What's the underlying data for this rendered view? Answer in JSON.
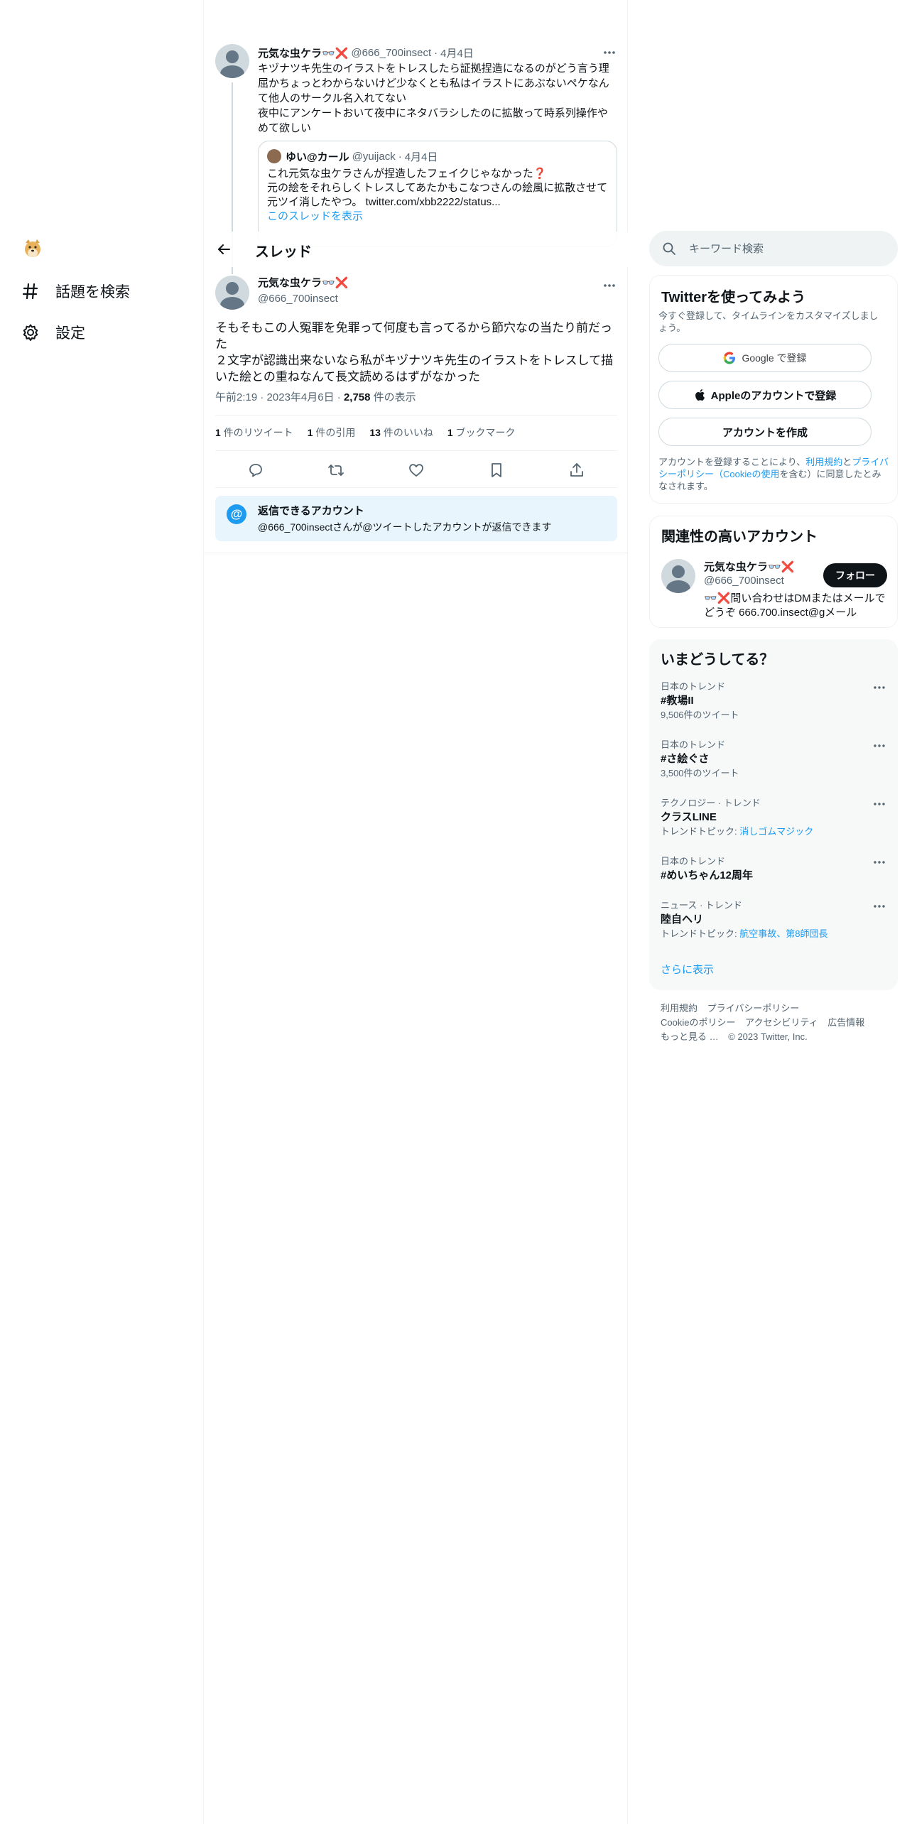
{
  "nav": {
    "items": [
      {
        "label": "話題を検索",
        "icon": "hash-icon"
      },
      {
        "label": "設定",
        "icon": "gear-icon"
      }
    ]
  },
  "parent_tweet": {
    "name": "元気な虫ケラ👓❌",
    "handle": "@666_700insect",
    "sep": "·",
    "date": "4月4日",
    "text_lines": [
      "キヅナツキ先生のイラストをトレスしたら証拠捏造になるのがどう言う理",
      "屈かちょっとわからないけど少なくとも私はイラストにあぶないペケなん",
      "て他人のサークル名入れてない",
      "夜中にアンケートおいて夜中にネタバラシしたのに拡散って時系列操作や",
      "めて欲しい"
    ],
    "quote": {
      "name": "ゆい@カール",
      "handle": "@yuijack",
      "sep": "·",
      "date": "4月4日",
      "lines": [
        "これ元気な虫ケラさんが捏造したフェイクじゃなかった❓",
        "元の絵をそれらしくトレスしてあたかもこなつさんの絵風に拡散させて",
        "元ツイ消したやつ。 twitter.com/xbb2222/status..."
      ],
      "show_thread": "このスレッドを表示"
    }
  },
  "header": {
    "title": "スレッド"
  },
  "focus_tweet": {
    "name": "元気な虫ケラ👓❌",
    "handle": "@666_700insect",
    "text_lines": [
      "そもそもこの人冤罪を免罪って何度も言ってるから節穴なの当たり前だっ",
      "た",
      "２文字が認識出来ないなら私がキヅナツキ先生のイラストをトレスして描",
      "いた絵との重ねなんて長文読めるはずがなかった"
    ],
    "time": "午前2:19",
    "sep1": "·",
    "date": "2023年4月6日",
    "sep2": "·",
    "views": "2,758",
    "views_label": "件の表示",
    "stats": [
      {
        "count": "1",
        "label": "件のリツイート"
      },
      {
        "count": "1",
        "label": "件の引用"
      },
      {
        "count": "13",
        "label": "件のいいね"
      },
      {
        "count": "1",
        "label": "ブックマーク"
      }
    ]
  },
  "reply_notice": {
    "title": "返信できるアカウント",
    "desc": "@666_700insectさんが@ツイートしたアカウントが返信できます"
  },
  "search": {
    "placeholder": "キーワード検索"
  },
  "signup": {
    "title": "Twitterを使ってみよう",
    "subtitle": "今すぐ登録して、タイムラインをカスタマイズしましょう。",
    "google": "Google で登録",
    "apple": "Appleのアカウントで登録",
    "create": "アカウントを作成",
    "terms_pre": "アカウントを登録することにより、",
    "terms_link1": "利用規約",
    "terms_and": "と",
    "terms_link2": "プライバシーポリシー（Cookieの使用",
    "terms_post": "を含む）に同意したとみなされます。"
  },
  "related": {
    "title": "関連性の高いアカウント",
    "name": "元気な虫ケラ👓❌",
    "handle": "@666_700insect",
    "follow": "フォロー",
    "bio": "👓❌問い合わせはDMまたはメールでどうぞ 666.700.insect@gメール"
  },
  "trends": {
    "title": "いまどうしてる？",
    "items": [
      {
        "category": "日本のトレンド",
        "name": "#教場II",
        "sub": "9,506件のツイート",
        "topic_label": "",
        "topic": ""
      },
      {
        "category": "日本のトレンド",
        "name": "#さ絵ぐさ",
        "sub": "3,500件のツイート",
        "topic_label": "",
        "topic": ""
      },
      {
        "category": "テクノロジー · トレンド",
        "name": "クラスLINE",
        "sub": "",
        "topic_label": "トレンドトピック: ",
        "topic": "消しゴムマジック"
      },
      {
        "category": "日本のトレンド",
        "name": "#めいちゃん12周年",
        "sub": "",
        "topic_label": "",
        "topic": ""
      },
      {
        "category": "ニュース · トレンド",
        "name": "陸自ヘリ",
        "sub": "",
        "topic_label": "トレンドトピック: ",
        "topic": "航空事故、第8師団長"
      }
    ],
    "show_more": "さらに表示"
  },
  "footer": {
    "links": [
      "利用規約",
      "プライバシーポリシー",
      "Cookieのポリシー",
      "アクセシビリティ",
      "広告情報",
      "もっと見る …"
    ],
    "copyright": "© 2023 Twitter, Inc."
  },
  "colors": {
    "accent": "#1d9bf0",
    "text": "#0f1419",
    "muted": "#536471"
  }
}
